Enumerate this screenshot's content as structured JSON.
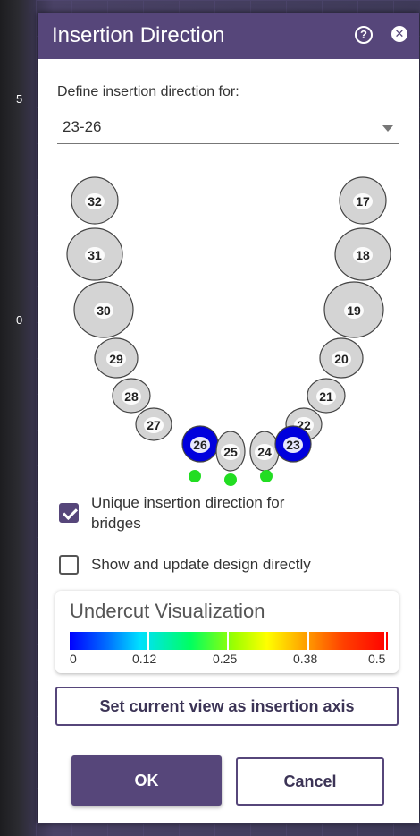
{
  "background": {
    "left_numbers": [
      "5",
      "0"
    ]
  },
  "dialog": {
    "title": "Insertion Direction",
    "help_icon": "help-icon",
    "close_icon": "close-icon",
    "define_label": "Define insertion direction for:",
    "selected_range": "23-26"
  },
  "teeth": {
    "upper_left": [
      "32",
      "31",
      "30",
      "29",
      "28",
      "27"
    ],
    "front": [
      "26",
      "25",
      "24",
      "23"
    ],
    "upper_right": [
      "17",
      "18",
      "19",
      "20",
      "21",
      "22"
    ],
    "highlighted": [
      "26",
      "23"
    ],
    "highlight_color": "#0000dd",
    "marker_color": "#22dd22"
  },
  "options": {
    "unique_bridges_label_line1": "Unique insertion direction for",
    "unique_bridges_label_line2": "bridges",
    "unique_bridges_checked": true,
    "show_update_label": "Show and update design directly",
    "show_update_checked": false
  },
  "undercut": {
    "title": "Undercut Visualization",
    "ticks": [
      "0",
      "0.12",
      "0.25",
      "0.38",
      "0.5"
    ]
  },
  "buttons": {
    "set_axis": "Set current view as insertion axis",
    "ok": "OK",
    "cancel": "Cancel"
  },
  "colors": {
    "accent": "#56467a"
  }
}
